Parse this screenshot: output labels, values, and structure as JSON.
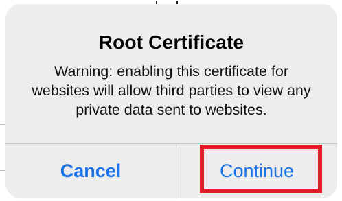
{
  "dialog": {
    "title": "Root Certificate",
    "message": "Warning: enabling this certificate for websites will allow third parties to view any private data sent to websites.",
    "buttons": {
      "cancel": "Cancel",
      "continue": "Continue"
    }
  },
  "colors": {
    "accent": "#1a73e8",
    "highlight": "#e11d2a",
    "dialog_background": "#ededee"
  }
}
